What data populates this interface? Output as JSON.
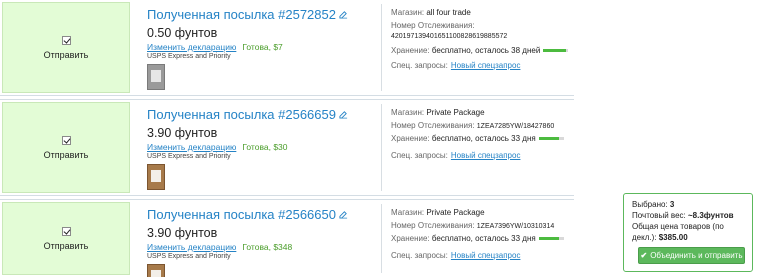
{
  "colors": {
    "accent": "#2583c6",
    "select_bg": "#e3fcd6",
    "ready": "#4a9d2a",
    "button": "#5cb85c"
  },
  "parcels": [
    {
      "send_label": "Отправить",
      "title": "Полученная посылка #2572852",
      "weight": "0.50 фунтов",
      "edit_declaration": "Изменить декларацию",
      "ready": "Готова, $7",
      "service": "USPS Express and Priority",
      "store_label": "Магазин:",
      "store": "all four trade",
      "tracking_label": "Номер Отслеживания:",
      "tracking": "420197139401651100828619885572",
      "storage_label": "Хранение:",
      "storage": "бесплатно, осталось 38 дней",
      "storage_level": 0.9,
      "special_label": "Спец. запросы:",
      "special_link": "Новый спецзапрос"
    },
    {
      "send_label": "Отправить",
      "title": "Полученная посылка #2566659",
      "weight": "3.90 фунтов",
      "edit_declaration": "Изменить декларацию",
      "ready": "Готова, $30",
      "service": "USPS Express and Priority",
      "store_label": "Магазин:",
      "store": "Private Package",
      "tracking_label": "Номер Отслеживания:",
      "tracking": "1ZEA7285YW/18427860",
      "storage_label": "Хранение:",
      "storage": "бесплатно, осталось 33 дня",
      "storage_level": 0.8,
      "special_label": "Спец. запросы:",
      "special_link": "Новый спецзапрос"
    },
    {
      "send_label": "Отправить",
      "title": "Полученная посылка #2566650",
      "weight": "3.90 фунтов",
      "edit_declaration": "Изменить декларацию",
      "ready": "Готова, $348",
      "service": "USPS Express and Priority",
      "store_label": "Магазин:",
      "store": "Private Package",
      "tracking_label": "Номер Отслеживания:",
      "tracking": "1ZEA7396YW/10310314",
      "storage_label": "Хранение:",
      "storage": "бесплатно, осталось 33 дня",
      "storage_level": 0.8,
      "special_label": "Спец. запросы:",
      "special_link": "Новый спецзапрос"
    }
  ],
  "summary": {
    "selected_label": "Выбрано:",
    "selected": "3",
    "weight_label": "Почтовый вес:",
    "weight": "~8.3фунтов",
    "total_label": "Общая цена товаров (по декл.):",
    "total": "$385.00",
    "merge_button": "Объединить и отправить"
  }
}
